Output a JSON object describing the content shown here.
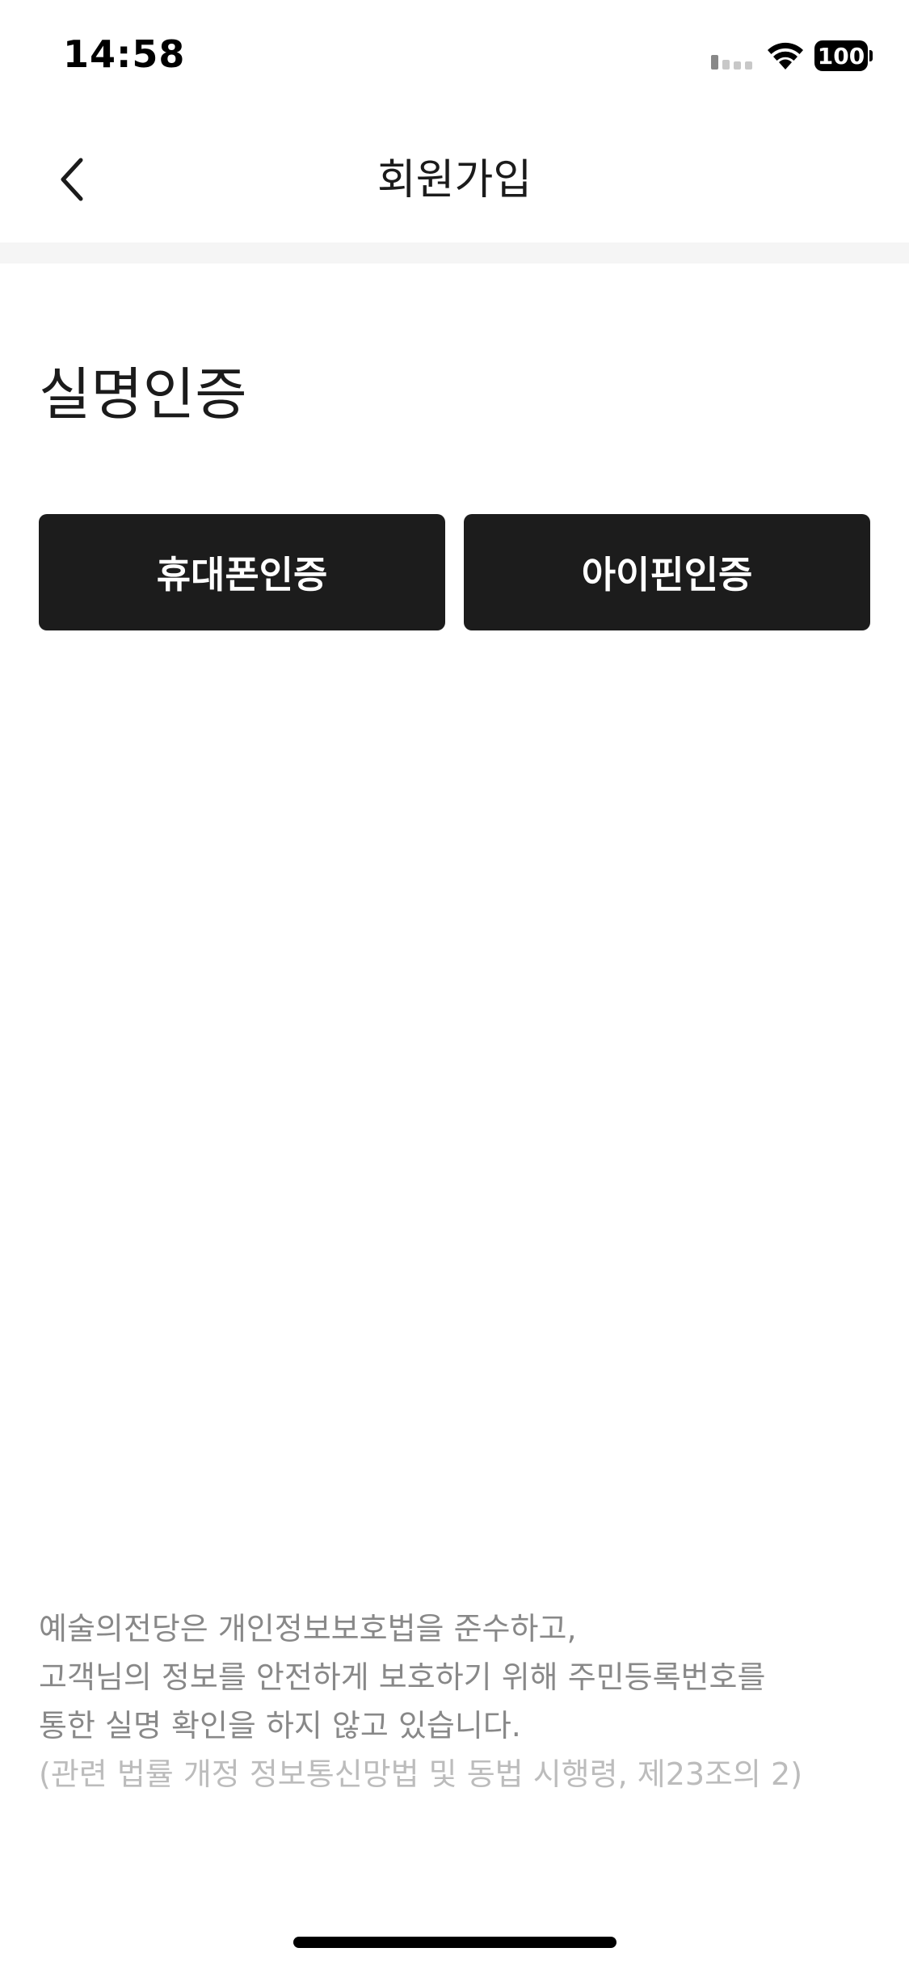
{
  "status_bar": {
    "time": "14:58",
    "battery": "100",
    "icons": [
      "signal-icon",
      "wifi-icon",
      "battery-icon"
    ]
  },
  "nav": {
    "title": "회원가입",
    "back_icon": "chevron-left-icon"
  },
  "content": {
    "section_title": "실명인증",
    "buttons": {
      "phone_auth": "휴대폰인증",
      "ipin_auth": "아이핀인증"
    },
    "notice": {
      "line1": "예술의전당은 개인정보보호법을 준수하고,",
      "line2": "고객님의 정보를 안전하게 보호하기 위해 주민등록번호를",
      "line3": "통한 실명 확인을 하지 않고 있습니다.",
      "line4": "(관련 법률 개정 정보통신망법 및 동법 시행령, 제23조의 2)"
    }
  },
  "colors": {
    "button_bg": "#1c1c1c",
    "notice_text": "#888888",
    "notice_muted": "#bcbcbc",
    "divider": "#f5f5f5"
  }
}
